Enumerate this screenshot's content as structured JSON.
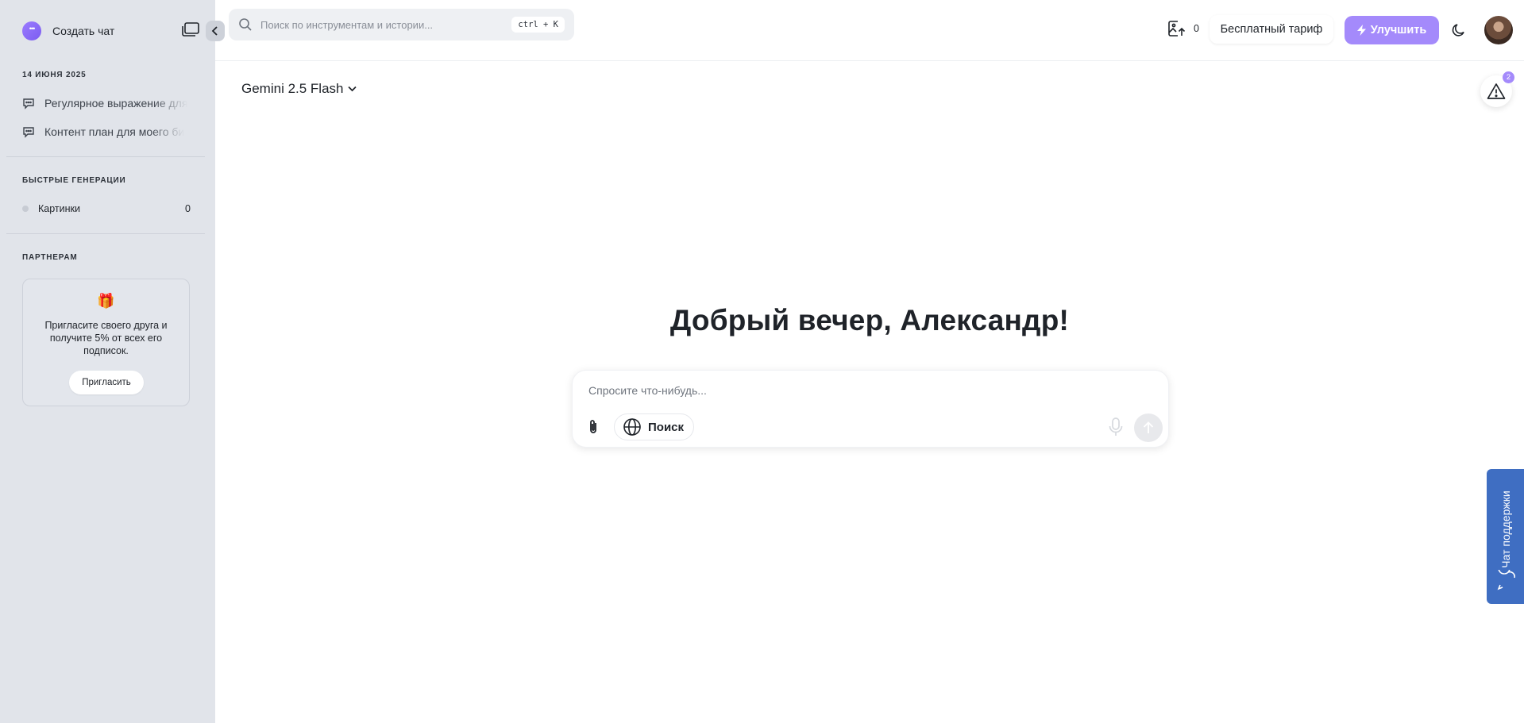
{
  "sidebar": {
    "new_chat_label": "Создать чат",
    "history_date": "14 ИЮНЯ 2025",
    "history": [
      {
        "label": "Регулярное выражение для"
      },
      {
        "label": "Контент план для моего би"
      }
    ],
    "quick_title": "БЫСТРЫЕ ГЕНЕРАЦИИ",
    "quick_item": {
      "label": "Картинки",
      "count": "0"
    },
    "partners_title": "ПАРТНЕРАМ",
    "partner_card": {
      "icon": "🎁",
      "text": "Пригласите своего друга и получите 5% от всех его подписок.",
      "button": "Пригласить"
    }
  },
  "topbar": {
    "search_placeholder": "Поиск по инструментам и истории...",
    "shortcut": "ctrl + K",
    "images_count": "0",
    "plan_label": "Бесплатный тариф",
    "upgrade_label": "Улучшить"
  },
  "main": {
    "model": "Gemini 2.5 Flash",
    "alerts_count": "2",
    "greeting": "Добрый вечер, Александр!",
    "composer_placeholder": "Спросите что-нибудь...",
    "web_search_label": "Поиск"
  },
  "support": {
    "label": "Чат поддержки"
  },
  "colors": {
    "accent": "#a48afb",
    "sidebar_bg": "#e1e4ea",
    "support": "#3f6ec2"
  }
}
